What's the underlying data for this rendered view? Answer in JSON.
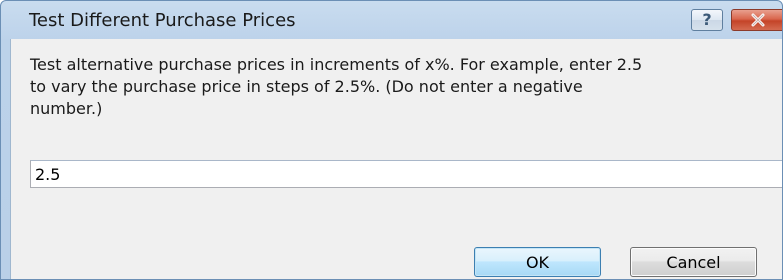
{
  "window": {
    "title": "Test Different Purchase Prices",
    "help_glyph": "?",
    "close_glyph": "✕",
    "colors": {
      "frame": "#b9d0e8",
      "client": "#f0f0f0",
      "close_button": "#c44428",
      "ok_button": "#a7d9f5"
    }
  },
  "message": {
    "lines": [
      "Test alternative purchase prices in increments of x%.  For example, enter 2.5",
      "to vary the purchase price in steps of 2.5%.  (Do not enter a negative",
      "number.)"
    ]
  },
  "increment_input": {
    "value": "2.5"
  },
  "buttons": {
    "ok_label": "OK",
    "cancel_label": "Cancel"
  }
}
